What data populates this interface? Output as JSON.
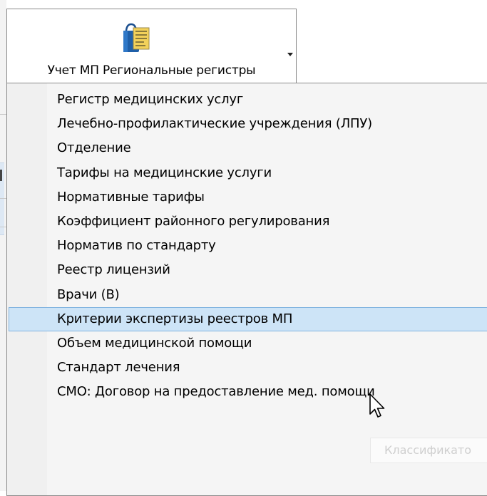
{
  "ribbon": {
    "button_label": "Учет МП Региональные регистры",
    "icon": "bag-document-icon",
    "dropdown_icon": "dropdown-arrow-icon"
  },
  "menu": {
    "hovered_index": 9,
    "items": [
      {
        "label": "Регистр медицинских услуг"
      },
      {
        "label": "Лечебно-профилактические учреждения (ЛПУ)"
      },
      {
        "label": "Отделение"
      },
      {
        "label": "Тарифы на медицинские услуги"
      },
      {
        "label": "Нормативные тарифы"
      },
      {
        "label": "Коэффициент  районного регулирования"
      },
      {
        "label": "Норматив по стандарту"
      },
      {
        "label": "Реестр лицензий"
      },
      {
        "label": "Врачи (В)"
      },
      {
        "label": "Критерии экспертизы реестров МП"
      },
      {
        "label": "Объем медицинской помощи"
      },
      {
        "label": "Стандарт лечения"
      },
      {
        "label": "СМО: Договор на предоставление мед. помощи"
      }
    ]
  },
  "tooltip": {
    "text": "Классификато"
  },
  "colors": {
    "hover_bg": "#cde4f7",
    "hover_border": "#82b4e0",
    "menu_bg": "#f5f5f5",
    "icon_blue": "#1f5fa8",
    "icon_doc": "#f2d15a"
  }
}
